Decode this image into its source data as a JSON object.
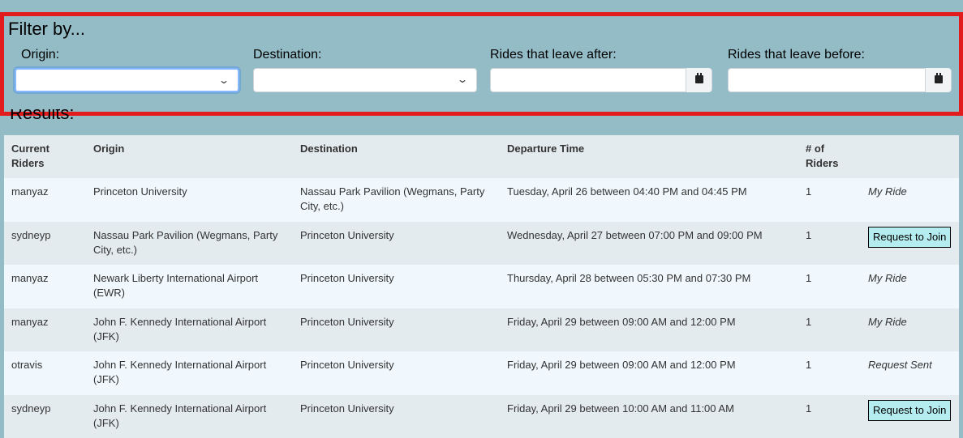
{
  "filter": {
    "title": "Filter by...",
    "fields": [
      {
        "label": "Origin:",
        "type": "select",
        "value": ""
      },
      {
        "label": "Destination:",
        "type": "select",
        "value": ""
      },
      {
        "label": "Rides that leave after:",
        "type": "date",
        "value": ""
      },
      {
        "label": "Rides that leave before:",
        "type": "date",
        "value": ""
      }
    ]
  },
  "results": {
    "title": "Results:",
    "columns": [
      "Current Riders",
      "Origin",
      "Destination",
      "Departure Time",
      "# of Riders",
      ""
    ],
    "rows": [
      {
        "rider": "manyaz",
        "origin": "Princeton University",
        "destination": "Nassau Park Pavilion (Wegmans, Party City, etc.)",
        "time": "Tuesday, April 26 between 04:40 PM and 04:45 PM",
        "count": "1",
        "action": "My Ride",
        "action_type": "text"
      },
      {
        "rider": "sydneyp",
        "origin": "Nassau Park Pavilion (Wegmans, Party City, etc.)",
        "destination": "Princeton University",
        "time": "Wednesday, April 27 between 07:00 PM and 09:00 PM",
        "count": "1",
        "action": "Request to Join",
        "action_type": "button"
      },
      {
        "rider": "manyaz",
        "origin": "Newark Liberty International Airport (EWR)",
        "destination": "Princeton University",
        "time": "Thursday, April 28 between 05:30 PM and 07:30 PM",
        "count": "1",
        "action": "My Ride",
        "action_type": "text"
      },
      {
        "rider": "manyaz",
        "origin": "John F. Kennedy International Airport (JFK)",
        "destination": "Princeton University",
        "time": "Friday, April 29 between 09:00 AM and 12:00 PM",
        "count": "1",
        "action": "My Ride",
        "action_type": "text"
      },
      {
        "rider": "otravis",
        "origin": "John F. Kennedy International Airport (JFK)",
        "destination": "Princeton University",
        "time": "Friday, April 29 between 09:00 AM and 12:00 PM",
        "count": "1",
        "action": "Request Sent",
        "action_type": "text"
      },
      {
        "rider": "sydneyp",
        "origin": "John F. Kennedy International Airport (JFK)",
        "destination": "Princeton University",
        "time": "Friday, April 29 between 10:00 AM and 11:00 AM",
        "count": "1",
        "action": "Request to Join",
        "action_type": "button"
      }
    ]
  },
  "icons": {
    "select_arrow": "chevron-down-icon",
    "date_picker": "calendar-icon"
  },
  "colors": {
    "background": "#94bcc6",
    "highlight_border": "#e21c1c",
    "join_button": "#b5ecef"
  }
}
